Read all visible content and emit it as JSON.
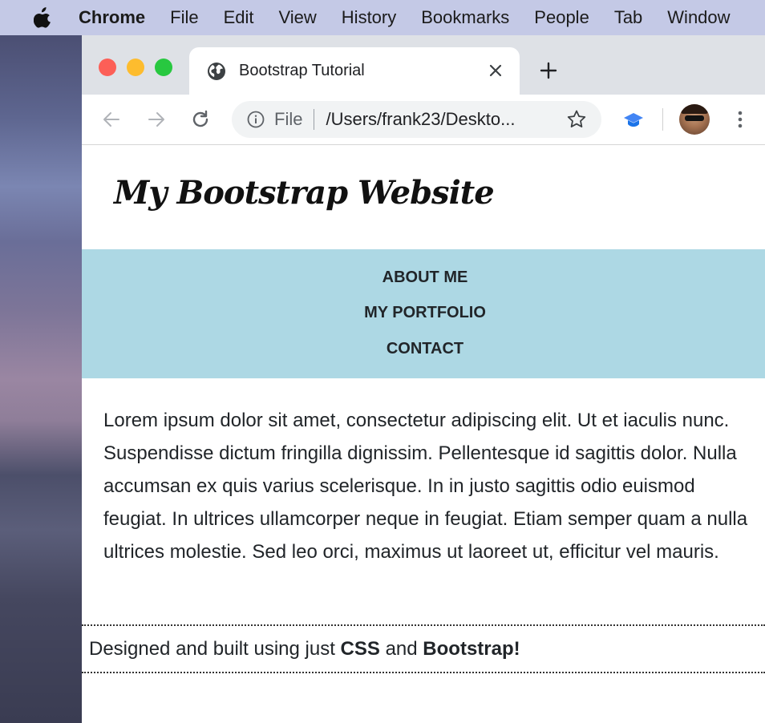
{
  "menubar": {
    "app": "Chrome",
    "items": [
      "File",
      "Edit",
      "View",
      "History",
      "Bookmarks",
      "People",
      "Tab",
      "Window"
    ]
  },
  "tab": {
    "title": "Bootstrap Tutorial"
  },
  "omnibox": {
    "scheme": "File",
    "url": "/Users/frank23/Deskto..."
  },
  "site": {
    "title": "My Bootstrap Website",
    "nav": [
      "ABOUT ME",
      "MY PORTFOLIO",
      "CONTACT"
    ],
    "body": "Lorem ipsum dolor sit amet, consectetur adipiscing elit. Ut et iaculis nunc. Suspendisse dictum fringilla dignissim. Pellentesque id sagittis dolor. Nulla accumsan ex quis varius scelerisque. In in justo sagittis odio euismod feugiat. In ultrices ullamcorper neque in feugiat. Etiam semper quam a nulla ultrices molestie. Sed leo orci, maximus ut laoreet ut, efficitur vel mauris.",
    "footer": {
      "prefix": "Designed and built using just ",
      "bold1": "CSS",
      "middle": " and ",
      "bold2": "Bootstrap!"
    }
  },
  "colors": {
    "menubar": "#c4c9e6",
    "tabbar": "#dee1e6",
    "nav_background": "#add8e4",
    "text": "#212529"
  }
}
